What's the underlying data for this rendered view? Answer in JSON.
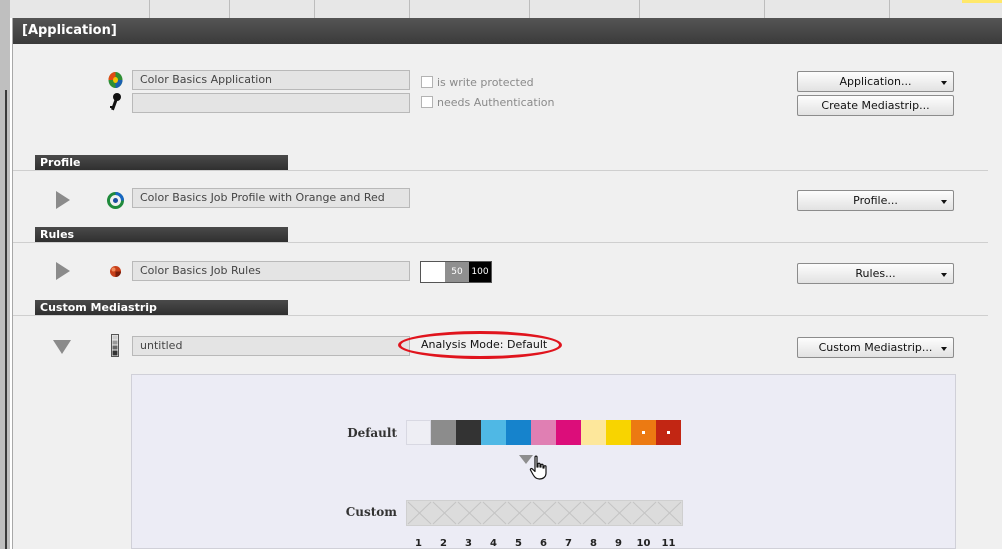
{
  "app": {
    "title": "[Application]"
  },
  "application": {
    "name_value": "Color Basics Application",
    "auth_value": "",
    "write_protected_label": "is write protected",
    "write_protected_checked": false,
    "needs_auth_label": "needs Authentication",
    "needs_auth_checked": false,
    "application_button": "Application...",
    "create_mediastrip_button": "Create Mediastrip...",
    "icons": [
      "color-basics-app-icon",
      "key-icon"
    ]
  },
  "profile": {
    "header": "Profile",
    "value": "Color Basics Job Profile with Orange and Red",
    "button": "Profile...",
    "icons": [
      "expand-triangle-icon",
      "profile-swirl-icon"
    ]
  },
  "rules": {
    "header": "Rules",
    "value": "Color Basics Job Rules",
    "gauge_50": "50",
    "gauge_100": "100",
    "button": "Rules...",
    "icons": [
      "expand-triangle-icon",
      "rules-ball-icon"
    ]
  },
  "custom_mediastrip": {
    "header": "Custom Mediastrip",
    "value": "untitled",
    "analysis_mode": "Analysis Mode: Default",
    "button": "Custom Mediastrip...",
    "icons": [
      "collapse-triangle-icon",
      "mediastrip-icon",
      "hand-cursor-icon",
      "insert-marker-icon"
    ],
    "annotation_color": "#e0141d",
    "default_label": "Default",
    "custom_label": "Custom",
    "default_patches": [
      "#eeeef4",
      "#8c8c8c",
      "#333333",
      "#4fb8e5",
      "#1683cc",
      "#e07fb3",
      "#dc0d7a",
      "#fde79b",
      "#f8d400",
      "#ec7a12",
      "#c22613"
    ],
    "custom_patches": [
      "",
      "",
      "",
      "",
      "",
      "",
      "",
      "",
      "",
      "",
      ""
    ],
    "patch_numbers": [
      "1",
      "2",
      "3",
      "4",
      "5",
      "6",
      "7",
      "8",
      "9",
      "10",
      "11"
    ]
  },
  "colors": {
    "header_bg": "#3e3e3e",
    "panel_bg": "#f0f0f0",
    "strip_area_bg": "#ececf5"
  }
}
